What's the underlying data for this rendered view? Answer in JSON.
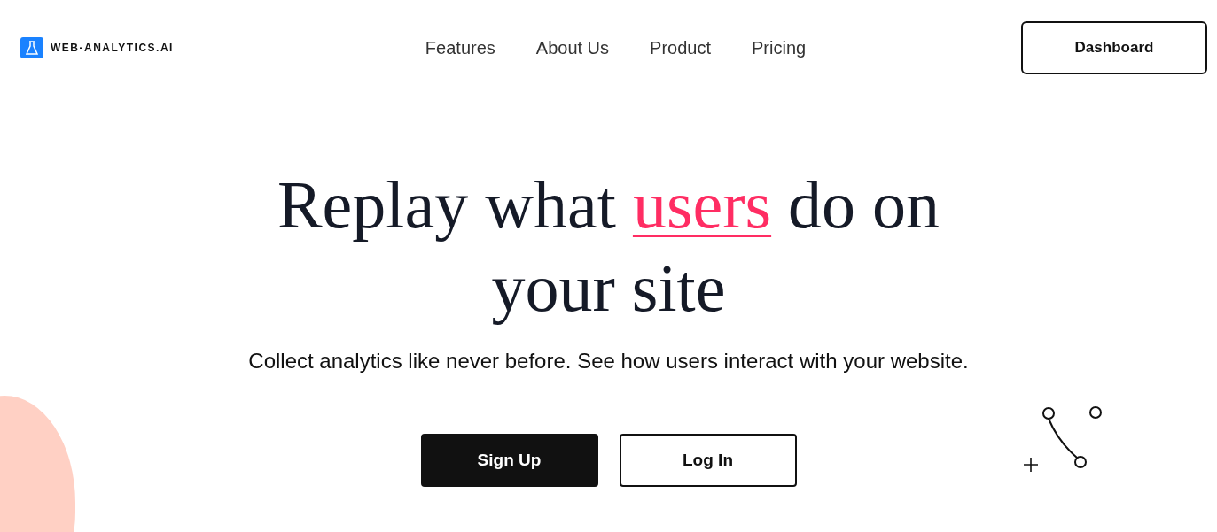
{
  "logo": {
    "text": "WEB-ANALYTICS.AI"
  },
  "nav": [
    "Features",
    "About Us",
    "Product",
    "Pricing"
  ],
  "header_button": "Dashboard",
  "hero": {
    "headline_before": "Replay what",
    "headline_highlight": "users",
    "headline_after": "do on your site",
    "subtitle": "Collect analytics like never before. See how users interact with your website."
  },
  "buttons": [
    {
      "label": "Sign Up",
      "kind": "primary"
    },
    {
      "label": "Log In",
      "kind": "secondary"
    }
  ]
}
